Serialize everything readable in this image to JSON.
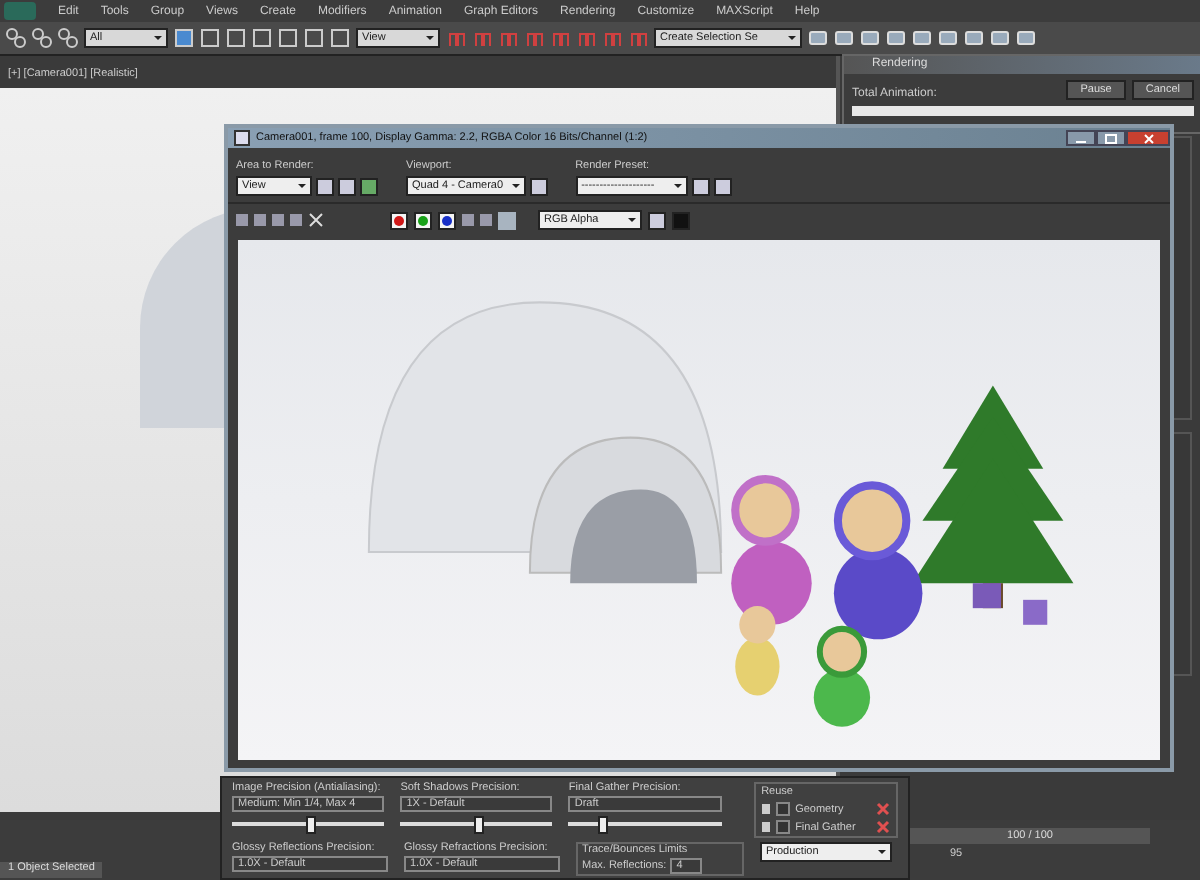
{
  "menu_bar": {
    "items": [
      "Edit",
      "Tools",
      "Group",
      "Views",
      "Create",
      "Modifiers",
      "Animation",
      "Graph Editors",
      "Rendering",
      "Customize",
      "MAXScript",
      "Help"
    ]
  },
  "toolbar": {
    "selection_filter": "All",
    "reference_coordinate": "View",
    "selection_set": "Create Selection Se"
  },
  "viewport": {
    "label": "[+] [Camera001] [Realistic]"
  },
  "rendering_dialog": {
    "title": "Rendering",
    "progress_label": "Total Animation:",
    "buttons": [
      "Pause",
      "Cancel"
    ],
    "level": 1
  },
  "frame_window": {
    "title": "Camera001, frame 100, Display Gamma: 2.2, RGBA Color 16 Bits/Channel (1:2)",
    "area_to_render": {
      "label": "Area to Render:",
      "value": "View"
    },
    "viewport": {
      "label": "Viewport:",
      "value": "Quad 4 - Camera0"
    },
    "render_preset": {
      "label": "Render Preset:",
      "value": "--------------------"
    },
    "channels": [
      {
        "color": "#d01818"
      },
      {
        "color": "#18a018"
      },
      {
        "color": "#1830c8"
      }
    ],
    "channel_display": "RGB Alpha"
  },
  "render_settings": {
    "fields": [
      {
        "label": "Image Precision (Antialiasing):",
        "value": "Medium: Min 1/4, Max 4",
        "level": 0.5
      },
      {
        "label": "Soft Shadows Precision:",
        "value": "1X - Default",
        "level": 0.5
      },
      {
        "label": "Final Gather Precision:",
        "value": "Draft",
        "level": 0.2
      }
    ],
    "glossy": [
      {
        "label": "Glossy Reflections Precision:",
        "value": "1.0X - Default"
      },
      {
        "label": "Glossy Refractions Precision:",
        "value": "1.0X - Default"
      }
    ],
    "trace": {
      "title": "Trace/Bounces Limits",
      "label": "Max. Reflections:",
      "value": "4"
    },
    "reuse": {
      "title": "Reuse",
      "items": [
        {
          "label": "Geometry",
          "checked": false
        },
        {
          "label": "Final Gather",
          "checked": false
        }
      ]
    },
    "preset": "Production"
  },
  "timeline": {
    "frame": "100 / 100",
    "tick": "95",
    "level": 1
  },
  "status_bar": {
    "text": "1 Object Selected"
  }
}
